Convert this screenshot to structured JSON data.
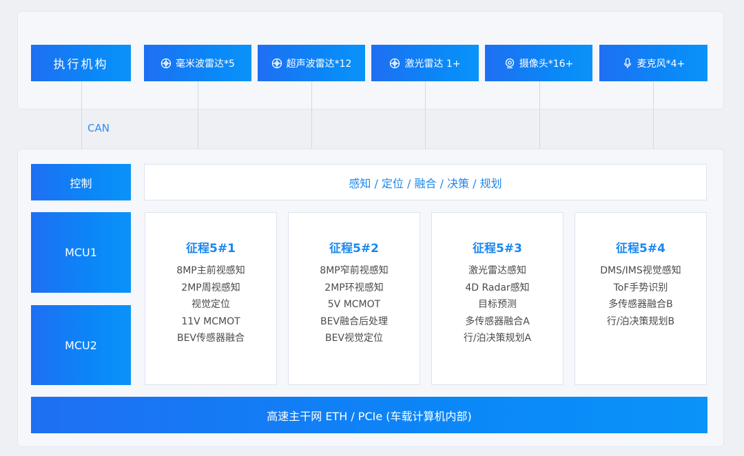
{
  "top": {
    "actuator": "执行机构",
    "sensors": [
      {
        "label": "毫米波雷达*5",
        "icon": "radar-icon"
      },
      {
        "label": "超声波雷达*12",
        "icon": "radar-icon"
      },
      {
        "label": "激光雷达 1+",
        "icon": "radar-icon"
      },
      {
        "label": "摄像头*16+",
        "icon": "camera-icon"
      },
      {
        "label": "麦克风*4+",
        "icon": "microphone-icon"
      }
    ]
  },
  "can_label": "CAN",
  "left": {
    "control": "控制",
    "mcu1": "MCU1",
    "mcu2": "MCU2"
  },
  "perception_bar": "感知 / 定位 / 融合 / 决策 / 规划",
  "cards": [
    {
      "title": "征程5#1",
      "lines": [
        "8MP主前视感知",
        "2MP周视感知",
        "视觉定位",
        "11V MCMOT",
        "BEV传感器融合"
      ]
    },
    {
      "title": "征程5#2",
      "lines": [
        "8MP窄前视感知",
        "2MP环视感知",
        "5V MCMOT",
        "BEV融合后处理",
        "BEV视觉定位"
      ]
    },
    {
      "title": "征程5#3",
      "lines": [
        "激光雷达感知",
        "4D Radar感知",
        "目标预测",
        "多传感器融合A",
        "行/泊决策规划A"
      ]
    },
    {
      "title": "征程5#4",
      "lines": [
        "DMS/IMS视觉感知",
        "ToF手势识别",
        "多传感器融合B",
        "行/泊决策规划B"
      ]
    }
  ],
  "bus_bar": "高速主干网 ETH / PCIe (车载计算机内部)",
  "colors": {
    "accent_blue": "#1a87f0",
    "box_gradient_start": "#1f6ff2",
    "box_gradient_end": "#0a93f9",
    "panel_bg": "#f5f7fb",
    "page_bg": "#eef0f4"
  }
}
